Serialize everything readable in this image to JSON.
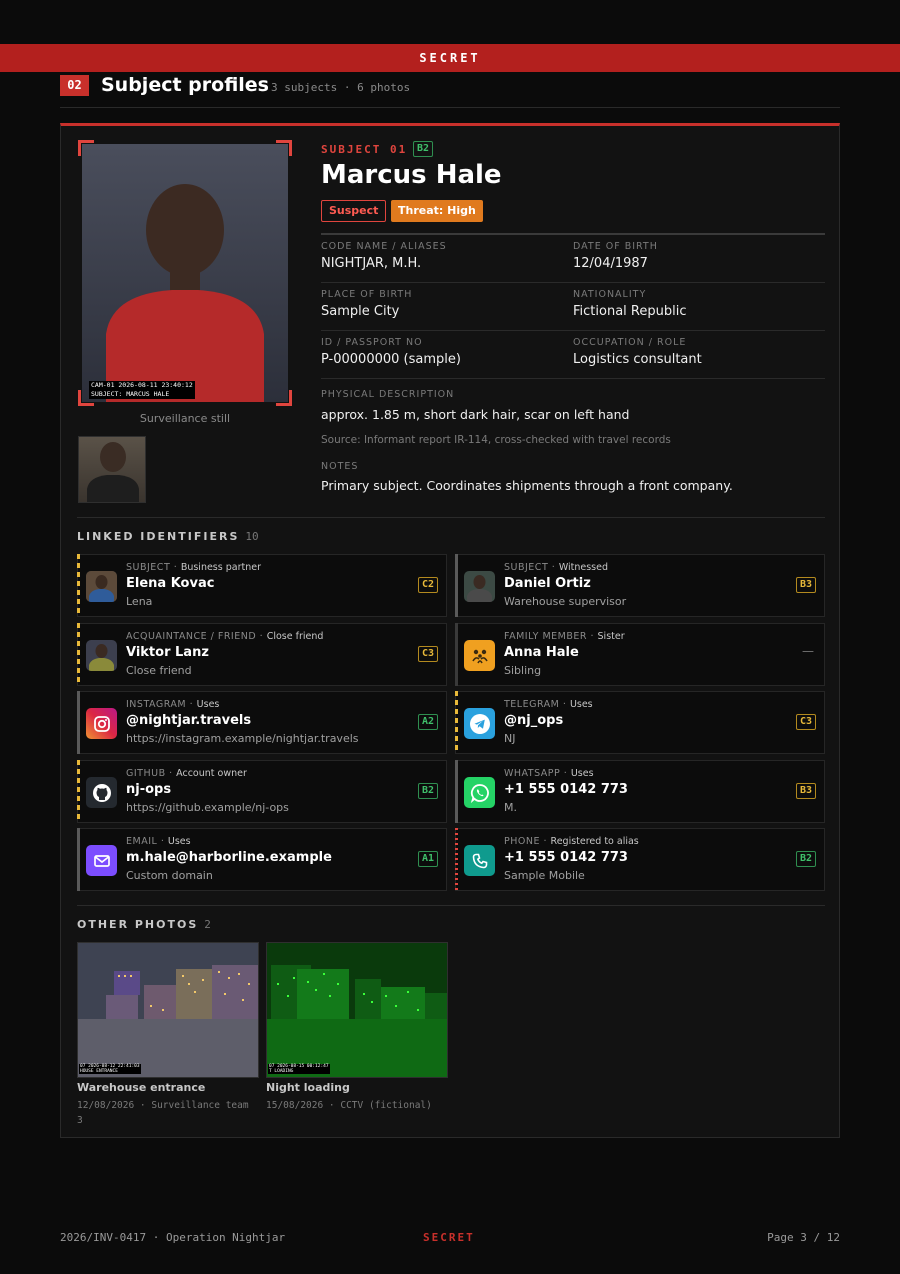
{
  "banner": {
    "classification": "SECRET"
  },
  "section": {
    "number": "02",
    "title": "Subject profiles",
    "summary": "3 subjects · 6 photos"
  },
  "subject": {
    "label": "SUBJECT 01",
    "grade": "B2",
    "name": "Marcus Hale",
    "status": "Suspect",
    "threat": "Threat: High",
    "photo": {
      "stamp_line1": "CAM-01  2026-08-11  23:40:12",
      "stamp_line2": "SUBJECT: MARCUS HALE",
      "caption": "Surveillance still"
    },
    "fields": [
      {
        "label": "CODE NAME / ALIASES",
        "value": "NIGHTJAR, M.H."
      },
      {
        "label": "DATE OF BIRTH",
        "value": "12/04/1987"
      },
      {
        "label": "PLACE OF BIRTH",
        "value": "Sample City"
      },
      {
        "label": "NATIONALITY",
        "value": "Fictional Republic"
      },
      {
        "label": "ID / PASSPORT NO",
        "value": "P-00000000 (sample)"
      },
      {
        "label": "OCCUPATION / ROLE",
        "value": "Logistics consultant"
      }
    ],
    "physical": {
      "label": "PHYSICAL DESCRIPTION",
      "value": "approx. 1.85 m, short dark hair, scar on left hand",
      "source": "Source: Informant report IR-114, cross-checked with travel records"
    },
    "notes": {
      "label": "NOTES",
      "value": "Primary subject. Coordinates shipments through a front company."
    }
  },
  "linked": {
    "title": "LINKED IDENTIFIERS",
    "count": "10",
    "items": [
      {
        "type": "SUBJECT",
        "rel": "Business partner",
        "name": "Elena Kovac",
        "sub": "Lena",
        "grade": "C2",
        "icon": "person-photo-icon"
      },
      {
        "type": "SUBJECT",
        "rel": "Witnessed",
        "name": "Daniel Ortiz",
        "sub": "Warehouse supervisor",
        "grade": "B3",
        "icon": "person-photo-icon"
      },
      {
        "type": "ACQUAINTANCE / FRIEND",
        "rel": "Close friend",
        "name": "Viktor Lanz",
        "sub": "Close friend",
        "grade": "C3",
        "icon": "person-photo-icon"
      },
      {
        "type": "FAMILY MEMBER",
        "rel": "Sister",
        "name": "Anna Hale",
        "sub": "Sibling",
        "grade": "—",
        "icon": "family-icon"
      },
      {
        "type": "INSTAGRAM",
        "rel": "Uses",
        "name": "@nightjar.travels",
        "sub": "https://instagram.example/nightjar.travels",
        "grade": "A2",
        "icon": "instagram-icon"
      },
      {
        "type": "TELEGRAM",
        "rel": "Uses",
        "name": "@nj_ops",
        "sub": "NJ",
        "grade": "C3",
        "icon": "telegram-icon"
      },
      {
        "type": "GITHUB",
        "rel": "Account owner",
        "name": "nj-ops",
        "sub": "https://github.example/nj-ops",
        "grade": "B2",
        "icon": "github-icon"
      },
      {
        "type": "WHATSAPP",
        "rel": "Uses",
        "name": "+1 555 0142 773",
        "sub": "M.",
        "grade": "B3",
        "icon": "whatsapp-icon"
      },
      {
        "type": "EMAIL",
        "rel": "Uses",
        "name": "m.hale@harborline.example",
        "sub": "Custom domain",
        "grade": "A1",
        "icon": "email-icon"
      },
      {
        "type": "PHONE",
        "rel": "Registered to alias",
        "name": "+1 555 0142 773",
        "sub": "Sample Mobile",
        "grade": "B2",
        "icon": "phone-icon"
      }
    ]
  },
  "other_photos": {
    "title": "OTHER PHOTOS",
    "count": "2",
    "items": [
      {
        "caption": "Warehouse entrance",
        "meta": "12/08/2026 · Surveillance team 3",
        "stamp1": "07  2026-08-12  22:41:03",
        "stamp2": "HOUSE ENTRANCE"
      },
      {
        "caption": "Night loading",
        "meta": "15/08/2026 · CCTV (fictional)",
        "stamp1": "07  2026-08-15  00:12:47",
        "stamp2": "T LOADING"
      }
    ]
  },
  "footer": {
    "case": "2026/INV-0417 · Operation Nightjar",
    "classification": "SECRET",
    "page": "Page 3 / 12"
  },
  "colors": {
    "accent_red": "#c8302b",
    "threat_orange": "#e07a1e",
    "grade_green": "#3fbf6a",
    "grade_yellow": "#e8b93a"
  }
}
